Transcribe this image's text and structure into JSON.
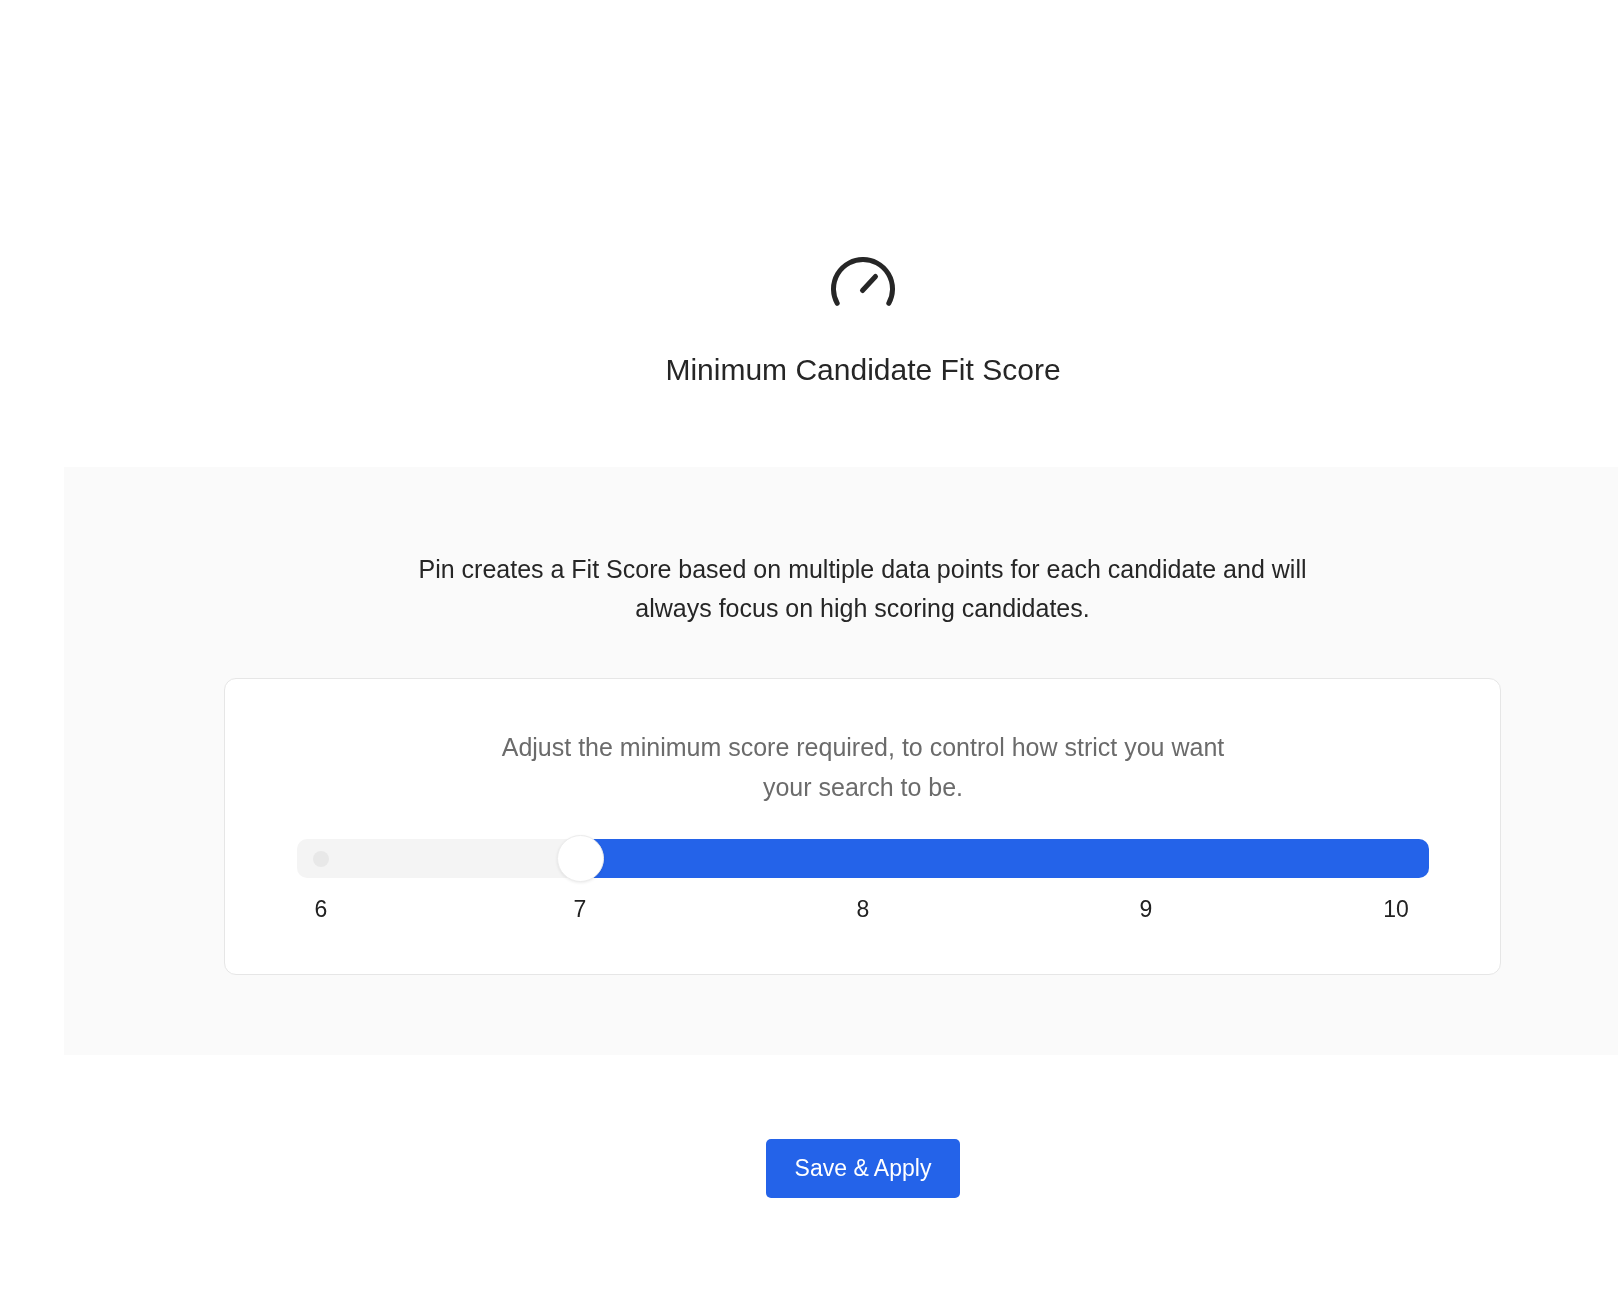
{
  "header": {
    "title": "Minimum Candidate Fit Score"
  },
  "panel": {
    "description": "Pin creates a Fit Score based on multiple data points for each candidate and will always focus on high scoring candidates.",
    "card": {
      "instruction": "Adjust the minimum score required, to control how strict you want your search to be.",
      "slider": {
        "level": 0.75,
        "ticks": [
          "6",
          "7",
          "8",
          "9",
          "10"
        ]
      }
    }
  },
  "actions": {
    "save_button": "Save & Apply"
  }
}
